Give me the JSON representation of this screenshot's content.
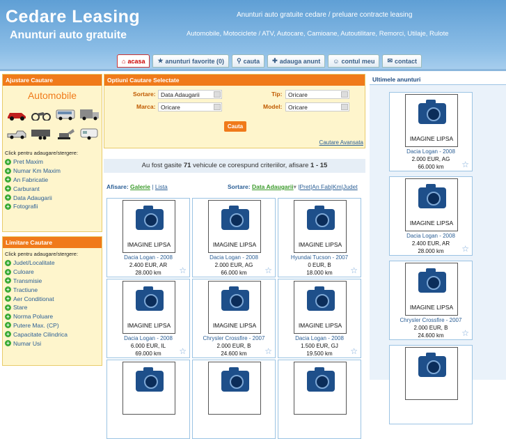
{
  "header": {
    "logo_main": "Cedare Leasing",
    "logo_sub": "Anunturi auto gratuite",
    "tagline1": "Anunturi auto gratuite cedare / preluare contracte leasing",
    "tagline2": "Automobile, Motociclete / ATV, Autocare, Camioane, Autoutilitare, Remorci, Utilaje, Rulote"
  },
  "nav": [
    {
      "label": "acasa",
      "icon": "home-icon",
      "glyph": "⌂"
    },
    {
      "label": "anunturi favorite (0)",
      "icon": "star-icon",
      "glyph": "★"
    },
    {
      "label": "cauta",
      "icon": "search-icon",
      "glyph": "⚲"
    },
    {
      "label": "adauga anunt",
      "icon": "plus-icon",
      "glyph": "✚"
    },
    {
      "label": "contul meu",
      "icon": "user-icon",
      "glyph": "☺"
    },
    {
      "label": "contact",
      "icon": "mail-icon",
      "glyph": "✉"
    }
  ],
  "left": {
    "adjust_title": "Ajustare Cautare",
    "category": "Automobile",
    "click_label": "Click pentru adaugare/stergere:",
    "adjust_options": [
      "Pret Maxim",
      "Numar Km Maxim",
      "An Fabricatie",
      "Carburant",
      "Data Adaugarii",
      "Fotografii"
    ],
    "limit_title": "Limitare Cautare",
    "limit_options": [
      "Judet/Localitate",
      "Culoare",
      "Transmisie",
      "Tractiune",
      "Aer Conditionat",
      "Stare",
      "Norma Poluare",
      "Putere Max. (CP)",
      "Capacitate Cilindrica",
      "Numar Usi"
    ]
  },
  "search": {
    "title": "Optiuni Cautare Selectate",
    "sort_label": "Sortare:",
    "sort_value": "Data Adaugarii",
    "type_label": "Tip:",
    "type_value": "Oricare",
    "make_label": "Marca:",
    "make_value": "Oricare",
    "model_label": "Model:",
    "model_value": "Oricare",
    "button": "Cauta",
    "advanced": "Cautare Avansata"
  },
  "result": {
    "prefix": "Au fost gasite ",
    "count": "71",
    "suffix": " vehicule ce corespund criteriilor, afisare ",
    "range": "1 - 15"
  },
  "view": {
    "display_label": "Afisare:",
    "gallery": "Galerie",
    "sep": "|",
    "list": "Lista",
    "sort_label": "Sortare:",
    "sort_current": "Data Adaugarii",
    "sort_others": [
      "|Pret",
      "|An Fab",
      "|Km",
      "|Judet"
    ]
  },
  "listings": [
    {
      "image": "IMAGINE LIPSA",
      "title": "Dacia Logan - 2008",
      "price": "2.400 EUR, AR",
      "km": "28.000 km"
    },
    {
      "image": "IMAGINE LIPSA",
      "title": "Dacia Logan - 2008",
      "price": "2.000 EUR, AG",
      "km": "66.000 km"
    },
    {
      "image": "IMAGINE LIPSA",
      "title": "Hyundai Tucson - 2007",
      "price": "0 EUR, B",
      "km": "18.000 km"
    },
    {
      "image": "IMAGINE LIPSA",
      "title": "Dacia Logan - 2008",
      "price": "6.000 EUR, IL",
      "km": "69.000 km"
    },
    {
      "image": "IMAGINE LIPSA",
      "title": "Chrysler Crossfire - 2007",
      "price": "2.000 EUR, B",
      "km": "24.600 km"
    },
    {
      "image": "IMAGINE LIPSA",
      "title": "Dacia Logan - 2008",
      "price": "1.500 EUR, GJ",
      "km": "19.500 km"
    }
  ],
  "right": {
    "title": "Ultimele anunturi",
    "items": [
      {
        "image": "IMAGINE LIPSA",
        "title": "Dacia Logan - 2008",
        "price": "2.000 EUR, AG",
        "km": "66.000 km"
      },
      {
        "image": "IMAGINE LIPSA",
        "title": "Dacia Logan - 2008",
        "price": "2.400 EUR, AR",
        "km": "28.000 km"
      },
      {
        "image": "IMAGINE LIPSA",
        "title": "Chrysler Crossfire - 2007",
        "price": "2.000 EUR, B",
        "km": "24.600 km"
      }
    ]
  },
  "colors": {
    "orange": "#f07a1a",
    "blue_header": "#6fa9da",
    "link": "#2a5e95"
  }
}
